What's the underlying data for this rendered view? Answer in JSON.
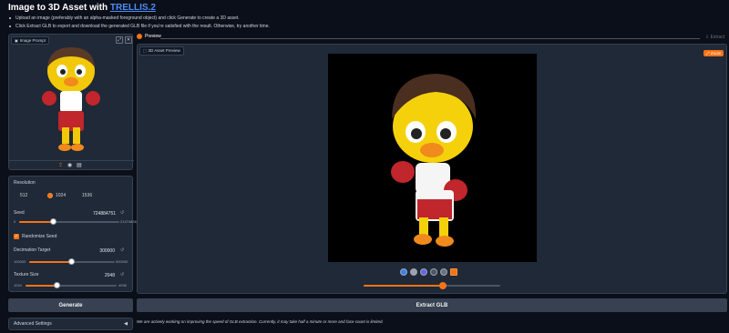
{
  "header": {
    "title_prefix": "Image to 3D Asset with ",
    "title_link": "TRELLIS.2",
    "bullets": [
      "Upload an image (preferably with an alpha-masked foreground object) and click Generate to create a 3D asset.",
      "Click Extract GLB to export and download the generated GLB file if you're satisfied with the result. Otherwise, try another time."
    ]
  },
  "left": {
    "image_prompt_label": "Image Prompt",
    "resolution": {
      "label": "Resolution",
      "options": [
        "512",
        "1024",
        "1536"
      ],
      "selected": "1024"
    },
    "seed": {
      "label": "Seed",
      "value": "724884751",
      "min": "0",
      "max": "2147483647",
      "fraction": 0.34
    },
    "randomize": {
      "label": "Randomize Seed",
      "checked": true
    },
    "decimation": {
      "label": "Decimation Target",
      "value": "300000",
      "min": "100000",
      "max": "500000",
      "fraction": 0.5
    },
    "texture": {
      "label": "Texture Size",
      "value": "2048",
      "min": "1024",
      "max": "4096",
      "fraction": 0.33
    },
    "generate_label": "Generate",
    "advanced_label": "Advanced Settings"
  },
  "right": {
    "tab_preview": "Preview",
    "tab_extract": "Extract",
    "asset_preview_label": "3D Asset Preview",
    "zoom_badge": "Zoom",
    "slider_fraction": 0.58,
    "extract_label": "Extract GLB",
    "note": "We are actively working on improving the speed of GLB extraction. Currently, it may take half a minute or more and face count is limited."
  },
  "colors": {
    "accent": "#f97316",
    "link": "#4c8df6",
    "background": "#0b0f19"
  }
}
